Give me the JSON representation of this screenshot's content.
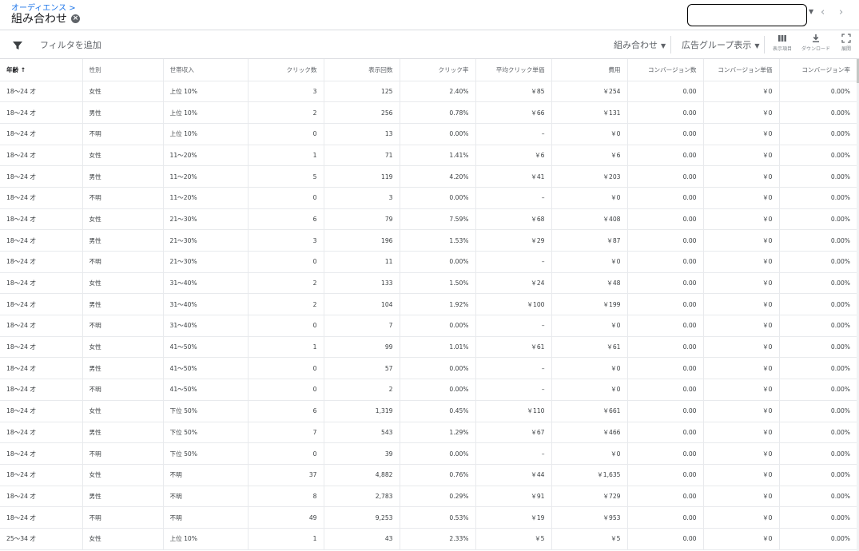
{
  "header": {
    "breadcrumb": "オーディエンス >",
    "title": "組み合わせ",
    "close_glyph": "×",
    "nav_prev": "‹",
    "nav_next": "›",
    "acct_caret": "▼"
  },
  "toolbar": {
    "filter_label": "フィルタを追加",
    "combo_label": "組み合わせ",
    "adgroup_label": "広告グループ表示",
    "caret": "▼",
    "columns_label": "表示項目",
    "download_label": "ダウンロード",
    "expand_label": "展開"
  },
  "table": {
    "headers": [
      "年齢 ↑",
      "性別",
      "世帯収入",
      "クリック数",
      "表示回数",
      "クリック率",
      "平均クリック単価",
      "費用",
      "コンバージョン数",
      "コンバージョン単価",
      "コンバージョン率"
    ],
    "rows": [
      [
        "18～24 才",
        "女性",
        "上位 10%",
        "3",
        "125",
        "2.40%",
        "￥85",
        "￥254",
        "0.00",
        "￥0",
        "0.00%"
      ],
      [
        "18～24 才",
        "男性",
        "上位 10%",
        "2",
        "256",
        "0.78%",
        "￥66",
        "￥131",
        "0.00",
        "￥0",
        "0.00%"
      ],
      [
        "18～24 才",
        "不明",
        "上位 10%",
        "0",
        "13",
        "0.00%",
        "–",
        "￥0",
        "0.00",
        "￥0",
        "0.00%"
      ],
      [
        "18～24 才",
        "女性",
        "11～20%",
        "1",
        "71",
        "1.41%",
        "￥6",
        "￥6",
        "0.00",
        "￥0",
        "0.00%"
      ],
      [
        "18～24 才",
        "男性",
        "11～20%",
        "5",
        "119",
        "4.20%",
        "￥41",
        "￥203",
        "0.00",
        "￥0",
        "0.00%"
      ],
      [
        "18～24 才",
        "不明",
        "11～20%",
        "0",
        "3",
        "0.00%",
        "–",
        "￥0",
        "0.00",
        "￥0",
        "0.00%"
      ],
      [
        "18～24 才",
        "女性",
        "21～30%",
        "6",
        "79",
        "7.59%",
        "￥68",
        "￥408",
        "0.00",
        "￥0",
        "0.00%"
      ],
      [
        "18～24 才",
        "男性",
        "21～30%",
        "3",
        "196",
        "1.53%",
        "￥29",
        "￥87",
        "0.00",
        "￥0",
        "0.00%"
      ],
      [
        "18～24 才",
        "不明",
        "21～30%",
        "0",
        "11",
        "0.00%",
        "–",
        "￥0",
        "0.00",
        "￥0",
        "0.00%"
      ],
      [
        "18～24 才",
        "女性",
        "31～40%",
        "2",
        "133",
        "1.50%",
        "￥24",
        "￥48",
        "0.00",
        "￥0",
        "0.00%"
      ],
      [
        "18～24 才",
        "男性",
        "31～40%",
        "2",
        "104",
        "1.92%",
        "￥100",
        "￥199",
        "0.00",
        "￥0",
        "0.00%"
      ],
      [
        "18～24 才",
        "不明",
        "31～40%",
        "0",
        "7",
        "0.00%",
        "–",
        "￥0",
        "0.00",
        "￥0",
        "0.00%"
      ],
      [
        "18～24 才",
        "女性",
        "41～50%",
        "1",
        "99",
        "1.01%",
        "￥61",
        "￥61",
        "0.00",
        "￥0",
        "0.00%"
      ],
      [
        "18～24 才",
        "男性",
        "41～50%",
        "0",
        "57",
        "0.00%",
        "–",
        "￥0",
        "0.00",
        "￥0",
        "0.00%"
      ],
      [
        "18～24 才",
        "不明",
        "41～50%",
        "0",
        "2",
        "0.00%",
        "–",
        "￥0",
        "0.00",
        "￥0",
        "0.00%"
      ],
      [
        "18～24 才",
        "女性",
        "下位 50%",
        "6",
        "1,319",
        "0.45%",
        "￥110",
        "￥661",
        "0.00",
        "￥0",
        "0.00%"
      ],
      [
        "18～24 才",
        "男性",
        "下位 50%",
        "7",
        "543",
        "1.29%",
        "￥67",
        "￥466",
        "0.00",
        "￥0",
        "0.00%"
      ],
      [
        "18～24 才",
        "不明",
        "下位 50%",
        "0",
        "39",
        "0.00%",
        "–",
        "￥0",
        "0.00",
        "￥0",
        "0.00%"
      ],
      [
        "18～24 才",
        "女性",
        "不明",
        "37",
        "4,882",
        "0.76%",
        "￥44",
        "￥1,635",
        "0.00",
        "￥0",
        "0.00%"
      ],
      [
        "18～24 才",
        "男性",
        "不明",
        "8",
        "2,783",
        "0.29%",
        "￥91",
        "￥729",
        "0.00",
        "￥0",
        "0.00%"
      ],
      [
        "18～24 才",
        "不明",
        "不明",
        "49",
        "9,253",
        "0.53%",
        "￥19",
        "￥953",
        "0.00",
        "￥0",
        "0.00%"
      ],
      [
        "25～34 才",
        "女性",
        "上位 10%",
        "1",
        "43",
        "2.33%",
        "￥5",
        "￥5",
        "0.00",
        "￥0",
        "0.00%"
      ]
    ]
  }
}
